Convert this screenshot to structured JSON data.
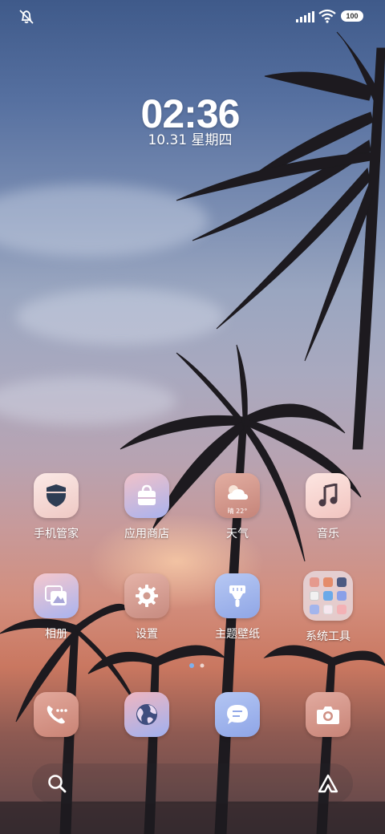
{
  "status_bar": {
    "icons": [
      "mute-icon",
      "signal-icon",
      "wifi-icon"
    ],
    "battery": "100"
  },
  "clock": {
    "time": "02:36",
    "date": "10.31  星期四"
  },
  "apps": {
    "row1": [
      {
        "label": "手机管家",
        "icon": "shield-icon"
      },
      {
        "label": "应用商店",
        "icon": "shopping-bag-icon"
      },
      {
        "label": "天气",
        "icon": "weather-icon",
        "temp": "晴 22°"
      },
      {
        "label": "音乐",
        "icon": "music-note-icon"
      }
    ],
    "row2": [
      {
        "label": "相册",
        "icon": "gallery-icon"
      },
      {
        "label": "设置",
        "icon": "gear-icon"
      },
      {
        "label": "主题壁纸",
        "icon": "paint-brush-icon"
      },
      {
        "label": "系统工具",
        "icon": "folder-icon"
      }
    ]
  },
  "dock": [
    "phone-icon",
    "browser-icon",
    "messages-icon",
    "camera-icon"
  ],
  "search_bar": {
    "icons": [
      "search-icon",
      "assistant-icon"
    ]
  },
  "colors": {
    "sky_top": "#3f5a8a",
    "sunset": "#d38e7d",
    "icon_pink": "#f3d8d6",
    "icon_lavender": "#b9c4ee",
    "icon_rose": "#c98c80"
  }
}
